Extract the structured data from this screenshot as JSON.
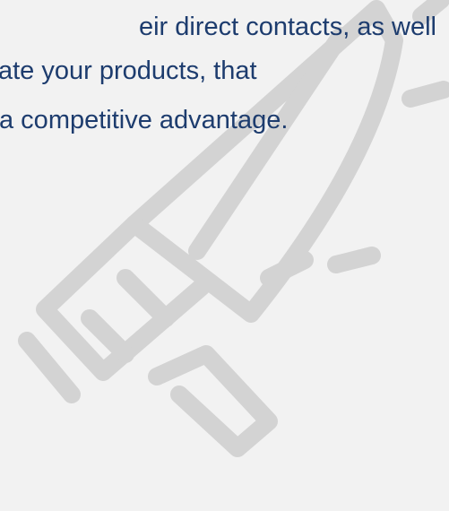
{
  "content": {
    "lines": [
      "eir direct contacts, as well",
      "ate your products, that",
      "a competitive advantage."
    ]
  },
  "colors": {
    "background": "#f2f2f2",
    "text": "#1d3c6e",
    "illustration_stroke": "#d3d3d3"
  },
  "illustration": {
    "icon": "megaphone-icon"
  }
}
